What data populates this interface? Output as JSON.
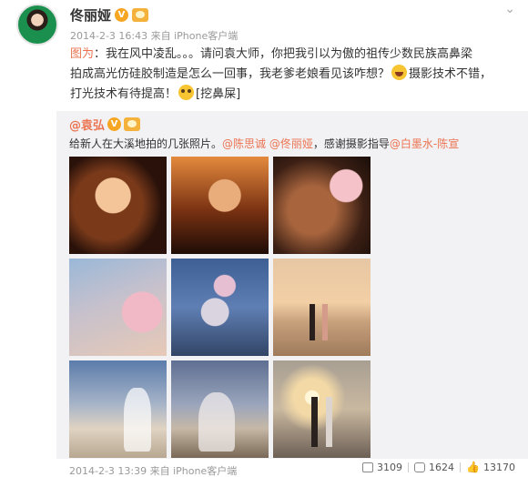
{
  "post": {
    "author": "佟丽娅",
    "verified_badge": "V",
    "meta": "2014-2-3 16:43 来自 iPhone客户端",
    "text_prefix": "图为",
    "text_line1": "：我在风中凌乱。。。请问袁大师，你把我引以为傲的祖传少数民族高鼻梁",
    "text_line2": "拍成高光仿硅胶制造是怎么一回事，我老爹老娘看见该咋想？",
    "text_line2b": "摄影技术不错，",
    "text_line3": "打光技术有待提高！",
    "text_line3b": "[挖鼻屎]"
  },
  "repost": {
    "author": "@袁弘",
    "verified_badge": "V",
    "text_main": "给新人在大溪地拍的几张照片。",
    "mentions": "@陈思诚 @佟丽娅",
    "text_mid": "，感谢摄影指导",
    "credit": "@白墨水-陈宣",
    "meta": "2014-2-3 13:39 来自 iPhone客户端",
    "shares": "3109",
    "comments": "1624",
    "likes": "13170"
  },
  "icons": {
    "chevron": "chevron-down-icon",
    "share": "share-icon",
    "comment": "comment-icon",
    "like": "thumbs-up-icon"
  },
  "colors": {
    "link": "#eb7350",
    "repost_bg": "#f2f2f5",
    "meta_text": "#999999"
  }
}
